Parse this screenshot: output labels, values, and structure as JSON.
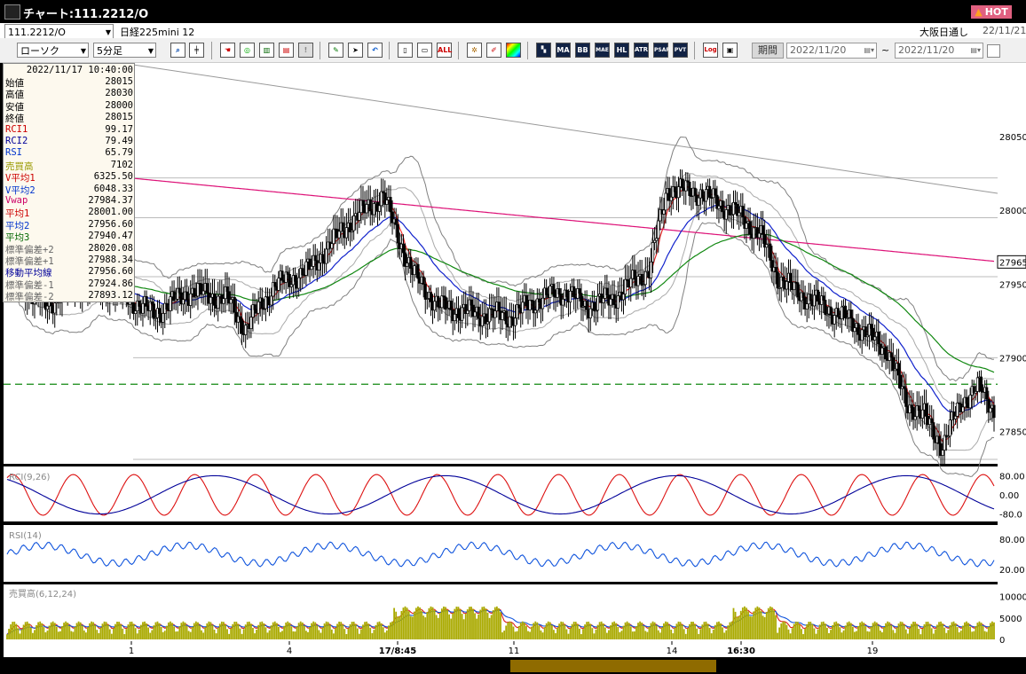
{
  "window": {
    "title": "チャート:111.2212/O",
    "hot_label": "HOT"
  },
  "symbol": {
    "code": "111.2212/O",
    "name": "日経225mini 12",
    "market": "大阪日通し",
    "date": "22/11/21"
  },
  "toolbar": {
    "chart_type": "ローソク",
    "interval": "5分足",
    "period_label": "期間",
    "date_from": "2022/11/20",
    "date_to": "2022/11/20",
    "range_sep": "~",
    "indicator_buttons": [
      "ALL",
      "MA",
      "BB",
      "MAE",
      "HL",
      "ATR",
      "PSAR",
      "PVT",
      "Log"
    ]
  },
  "info_panel": {
    "timestamp": "2022/11/17  10:40:00",
    "rows": [
      {
        "label": "始値",
        "value": "28015",
        "color": "#000000"
      },
      {
        "label": "高値",
        "value": "28030",
        "color": "#000000"
      },
      {
        "label": "安値",
        "value": "28000",
        "color": "#000000"
      },
      {
        "label": "終値",
        "value": "28015",
        "color": "#000000"
      },
      {
        "label": "RCI1",
        "value": "99.17",
        "color": "#cc0000"
      },
      {
        "label": "RCI2",
        "value": "79.49",
        "color": "#000099"
      },
      {
        "label": "RSI",
        "value": "65.79",
        "color": "#0033cc"
      },
      {
        "label": "売買高",
        "value": "7102",
        "color": "#999900"
      },
      {
        "label": "V平均1",
        "value": "6325.50",
        "color": "#cc0000"
      },
      {
        "label": "V平均2",
        "value": "6048.33",
        "color": "#0033cc"
      },
      {
        "label": "Vwap",
        "value": "27984.37",
        "color": "#cc0066"
      },
      {
        "label": "平均1",
        "value": "28001.00",
        "color": "#cc0000"
      },
      {
        "label": "平均2",
        "value": "27956.60",
        "color": "#0033cc"
      },
      {
        "label": "平均3",
        "value": "27940.47",
        "color": "#006600"
      },
      {
        "label": "標準偏差+2",
        "value": "28020.08",
        "color": "#666666"
      },
      {
        "label": "標準偏差+1",
        "value": "27988.34",
        "color": "#666666"
      },
      {
        "label": "移動平均線",
        "value": "27956.60",
        "color": "#000099"
      },
      {
        "label": "標準偏差-1",
        "value": "27924.86",
        "color": "#666666"
      },
      {
        "label": "標準偏差-2",
        "value": "27893.12",
        "color": "#666666"
      }
    ]
  },
  "price_axis": {
    "ticks": [
      "28050",
      "28000",
      "27950",
      "27900",
      "27850"
    ],
    "current": "27965"
  },
  "rci_panel": {
    "label": "RCI(9,26)",
    "ticks": [
      "80.00",
      "0.00",
      "-80.0"
    ]
  },
  "rsi_panel": {
    "label": "RSI(14)",
    "ticks": [
      "80.00",
      "20.00"
    ]
  },
  "volume_panel": {
    "label": "売買高(6,12,24)",
    "ticks": [
      "10000",
      "5000",
      "0"
    ]
  },
  "x_axis": {
    "labels": [
      "1",
      "4",
      "17/8:45",
      "11",
      "14",
      "16:30",
      "19"
    ]
  },
  "colors": {
    "bg": "#ffffff",
    "candle": "#000000",
    "ma1": "#ee2222",
    "ma2": "#1122cc",
    "ma3": "#118811",
    "vwap": "#dd1177",
    "band": "#808080",
    "rci1": "#dd1111",
    "rci2": "#000099",
    "rsi": "#1155dd",
    "volume": "#aaaa00"
  },
  "chart_data": {
    "type": "candlestick",
    "price_axis_ticks": [
      28050,
      28000,
      27950,
      27900,
      27850
    ],
    "price_range": [
      27828,
      28100
    ],
    "current_price": 27965,
    "dashed_level": 27882,
    "horizontal_levels": [
      28022,
      27995,
      27955,
      27900,
      27831
    ],
    "rci_axis": [
      -100,
      100
    ],
    "rsi_axis": [
      0,
      100
    ],
    "volume_axis": [
      0,
      12000
    ]
  }
}
